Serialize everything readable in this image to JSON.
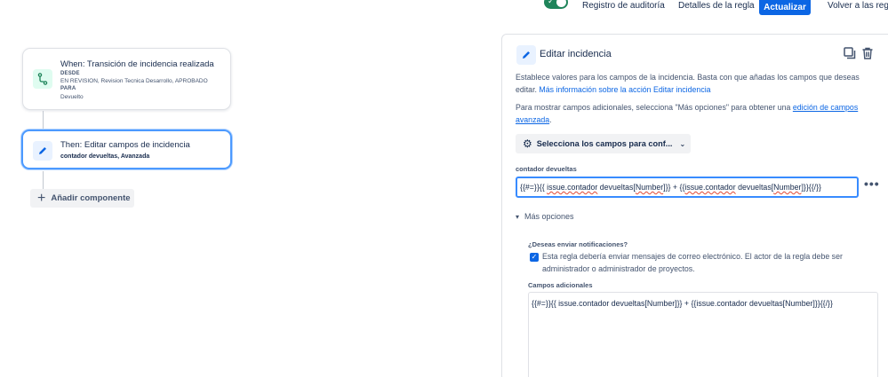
{
  "topbar": {
    "audit_label": "Registro de auditoría",
    "details_label": "Detalles de la regla",
    "update_label": "Actualizar",
    "back_label": "Volver a las regla"
  },
  "trigger": {
    "title": "When: Transición de incidencia realizada",
    "from_label": "DESDE",
    "from_value": "EN REVISION, Revision Tecnica Desarrollo, APROBADO",
    "to_label": "PARA",
    "to_value": "Devuelto",
    "icon": "branch-icon"
  },
  "action": {
    "title": "Then: Editar campos de incidencia",
    "subtitle": "contador devueltas, Avanzada",
    "icon": "pencil-icon"
  },
  "add_component_label": "Añadir componente",
  "panel": {
    "title": "Editar incidencia",
    "description": "Establece valores para los campos de la incidencia. Basta con que añadas los campos que deseas editar.",
    "description_link": "Más información sobre la acción Editar incidencia",
    "more_fields_text": "Para mostrar campos adicionales, selecciona \"Más opciones\" para obtener una",
    "more_fields_link": "edición de campos avanzada",
    "more_fields_end": ".",
    "select_fields_label": "Selecciona los campos para conf...",
    "field_label": "contador devueltas",
    "field_value_prefix": "{{#=}}{{ ",
    "field_value_w1": "issue.contador",
    "field_value_mid1": " devueltas[",
    "field_value_w2": "Number",
    "field_value_mid2": "]}} + {{",
    "field_value_w3": "issue.contador",
    "field_value_mid3": " devueltas[",
    "field_value_w4": "Number",
    "field_value_suffix": "]}}{{/}}",
    "more_options_label": "Más opciones",
    "notify_label": "¿Deseas enviar notificaciones?",
    "notify_text": "Esta regla debería enviar mensajes de correo electrónico. El actor de la regla debe ser administrador o administrador de proyectos.",
    "notify_checked": true,
    "additional_label": "Campos adicionales",
    "additional_value": "{{#=}}{{ issue.contador devueltas[Number]}} + {{issue.contador devueltas[Number]}}{{/}}"
  },
  "colors": {
    "primary": "#0c66e4",
    "toggle_on": "#1f845a",
    "focus": "#388bff"
  }
}
